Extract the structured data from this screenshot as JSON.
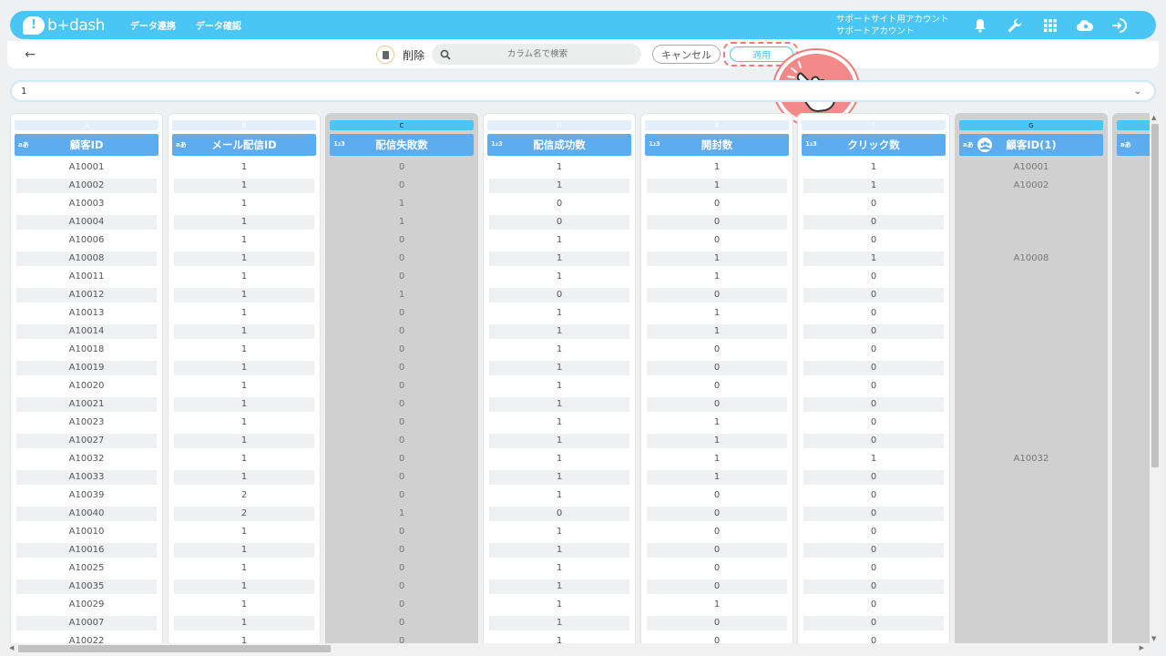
{
  "header": {
    "logo_text": "b+dash",
    "nav": [
      "データ連携",
      "データ確認"
    ],
    "account_line1": "サポートサイト用アカウント",
    "account_line2": "サポートアカウント",
    "icons": [
      "bell-icon",
      "wrench-icon",
      "grid-icon",
      "cloud-icon",
      "logout-icon"
    ]
  },
  "toolbar": {
    "delete_label": "削除",
    "search_placeholder": "カラム名で検索",
    "cancel_label": "キャンセル",
    "apply_label": "適用"
  },
  "selector": {
    "value": "1"
  },
  "colors": {
    "brand": "#49c6f3",
    "header_blue": "#5cacef",
    "highlight": "#f07a7a",
    "disabled_col": "#d0d0d0"
  },
  "columns": [
    {
      "letter": "A",
      "type": "aあ",
      "title": "顧客ID",
      "shaded": false,
      "selected": false,
      "values": [
        "A10001",
        "A10002",
        "A10003",
        "A10004",
        "A10006",
        "A10008",
        "A10011",
        "A10012",
        "A10013",
        "A10014",
        "A10018",
        "A10019",
        "A10020",
        "A10021",
        "A10023",
        "A10027",
        "A10032",
        "A10033",
        "A10039",
        "A10040",
        "A10010",
        "A10016",
        "A10025",
        "A10035",
        "A10029",
        "A10007",
        "A10022"
      ]
    },
    {
      "letter": "B",
      "type": "aあ",
      "title": "メール配信ID",
      "shaded": false,
      "selected": false,
      "values": [
        "1",
        "1",
        "1",
        "1",
        "1",
        "1",
        "1",
        "1",
        "1",
        "1",
        "1",
        "1",
        "1",
        "1",
        "1",
        "1",
        "1",
        "1",
        "2",
        "2",
        "1",
        "1",
        "1",
        "1",
        "1",
        "1",
        "1"
      ]
    },
    {
      "letter": "C",
      "type": "1₂3",
      "title": "配信失敗数",
      "shaded": true,
      "selected": true,
      "values": [
        "0",
        "0",
        "1",
        "1",
        "0",
        "0",
        "0",
        "1",
        "0",
        "0",
        "0",
        "0",
        "0",
        "0",
        "0",
        "0",
        "0",
        "0",
        "0",
        "1",
        "0",
        "0",
        "0",
        "0",
        "0",
        "0",
        "0"
      ]
    },
    {
      "letter": "D",
      "type": "1₂3",
      "title": "配信成功数",
      "shaded": false,
      "selected": false,
      "values": [
        "1",
        "1",
        "0",
        "0",
        "1",
        "1",
        "1",
        "0",
        "1",
        "1",
        "1",
        "1",
        "1",
        "1",
        "1",
        "1",
        "1",
        "1",
        "1",
        "0",
        "1",
        "1",
        "1",
        "1",
        "1",
        "1",
        "1"
      ]
    },
    {
      "letter": "E",
      "type": "1₂3",
      "title": "開封数",
      "shaded": false,
      "selected": false,
      "values": [
        "1",
        "1",
        "0",
        "0",
        "0",
        "1",
        "1",
        "0",
        "1",
        "1",
        "0",
        "0",
        "0",
        "0",
        "1",
        "1",
        "1",
        "1",
        "0",
        "0",
        "0",
        "0",
        "0",
        "0",
        "1",
        "0",
        "0"
      ]
    },
    {
      "letter": "F",
      "type": "1₂3",
      "title": "クリック数",
      "shaded": false,
      "selected": false,
      "values": [
        "1",
        "1",
        "0",
        "0",
        "0",
        "1",
        "0",
        "0",
        "0",
        "0",
        "0",
        "0",
        "0",
        "0",
        "0",
        "0",
        "1",
        "0",
        "0",
        "0",
        "0",
        "0",
        "0",
        "0",
        "0",
        "0",
        "0"
      ]
    },
    {
      "letter": "G",
      "type": "aあ",
      "title": "顧客ID(1)",
      "shaded": true,
      "selected": true,
      "grouped": true,
      "values": [
        "A10001",
        "A10002",
        "",
        "",
        "",
        "A10008",
        "",
        "",
        "",
        "",
        "",
        "",
        "",
        "",
        "",
        "",
        "A10032",
        "",
        "",
        "",
        "",
        "",
        "",
        "",
        "",
        "",
        ""
      ]
    },
    {
      "letter": "",
      "type": "aあ",
      "title": "",
      "shaded": true,
      "selected": true,
      "values": []
    }
  ]
}
